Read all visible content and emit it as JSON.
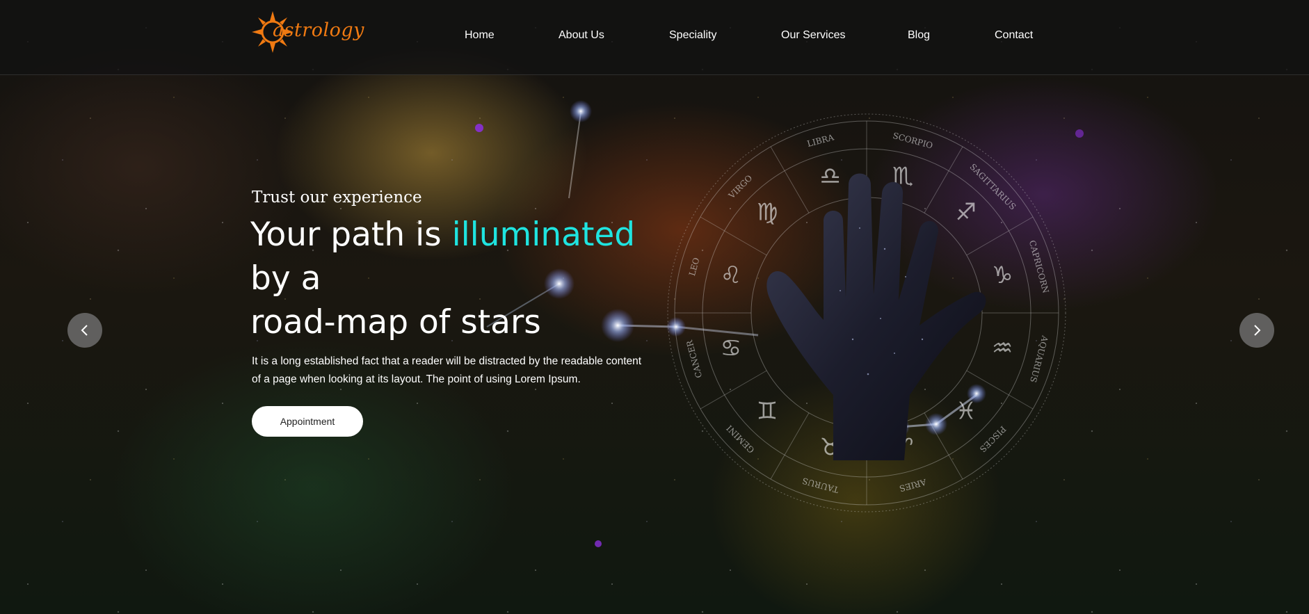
{
  "header": {
    "logo_text": "astrology",
    "nav": [
      {
        "label": "Home"
      },
      {
        "label": "About Us"
      },
      {
        "label": "Speciality"
      },
      {
        "label": "Our Services"
      },
      {
        "label": "Blog"
      },
      {
        "label": "Contact"
      }
    ]
  },
  "hero": {
    "subtitle": "Trust our experience",
    "title_part1": "Your path is ",
    "title_accent": "illuminated",
    "title_line2": "by a",
    "title_line3": "road-map of stars",
    "description_line1": "It is a long established fact that a reader will be distracted by the readable content",
    "description_line2": "of a page when looking at its layout. The point of using Lorem Ipsum.",
    "button_label": "Appointment"
  },
  "zodiac_wheel": {
    "signs": [
      "SCORPIO",
      "SAGITTARIUS",
      "CAPRICORN",
      "AQUARIUS",
      "PISCES",
      "ARIES",
      "TAURUS",
      "GEMINI",
      "CANCER",
      "LEO",
      "VIRGO",
      "LIBRA"
    ],
    "symbols": [
      "♏",
      "♐",
      "♑",
      "♒",
      "♓",
      "♈",
      "♉",
      "♊",
      "♋",
      "♌",
      "♍",
      "♎"
    ]
  },
  "slider": {
    "prev_icon": "chevron-left-icon",
    "next_icon": "chevron-right-icon"
  },
  "colors": {
    "accent": "#1fe4e0",
    "logo": "#f07a12",
    "header_bg": "#121212"
  }
}
